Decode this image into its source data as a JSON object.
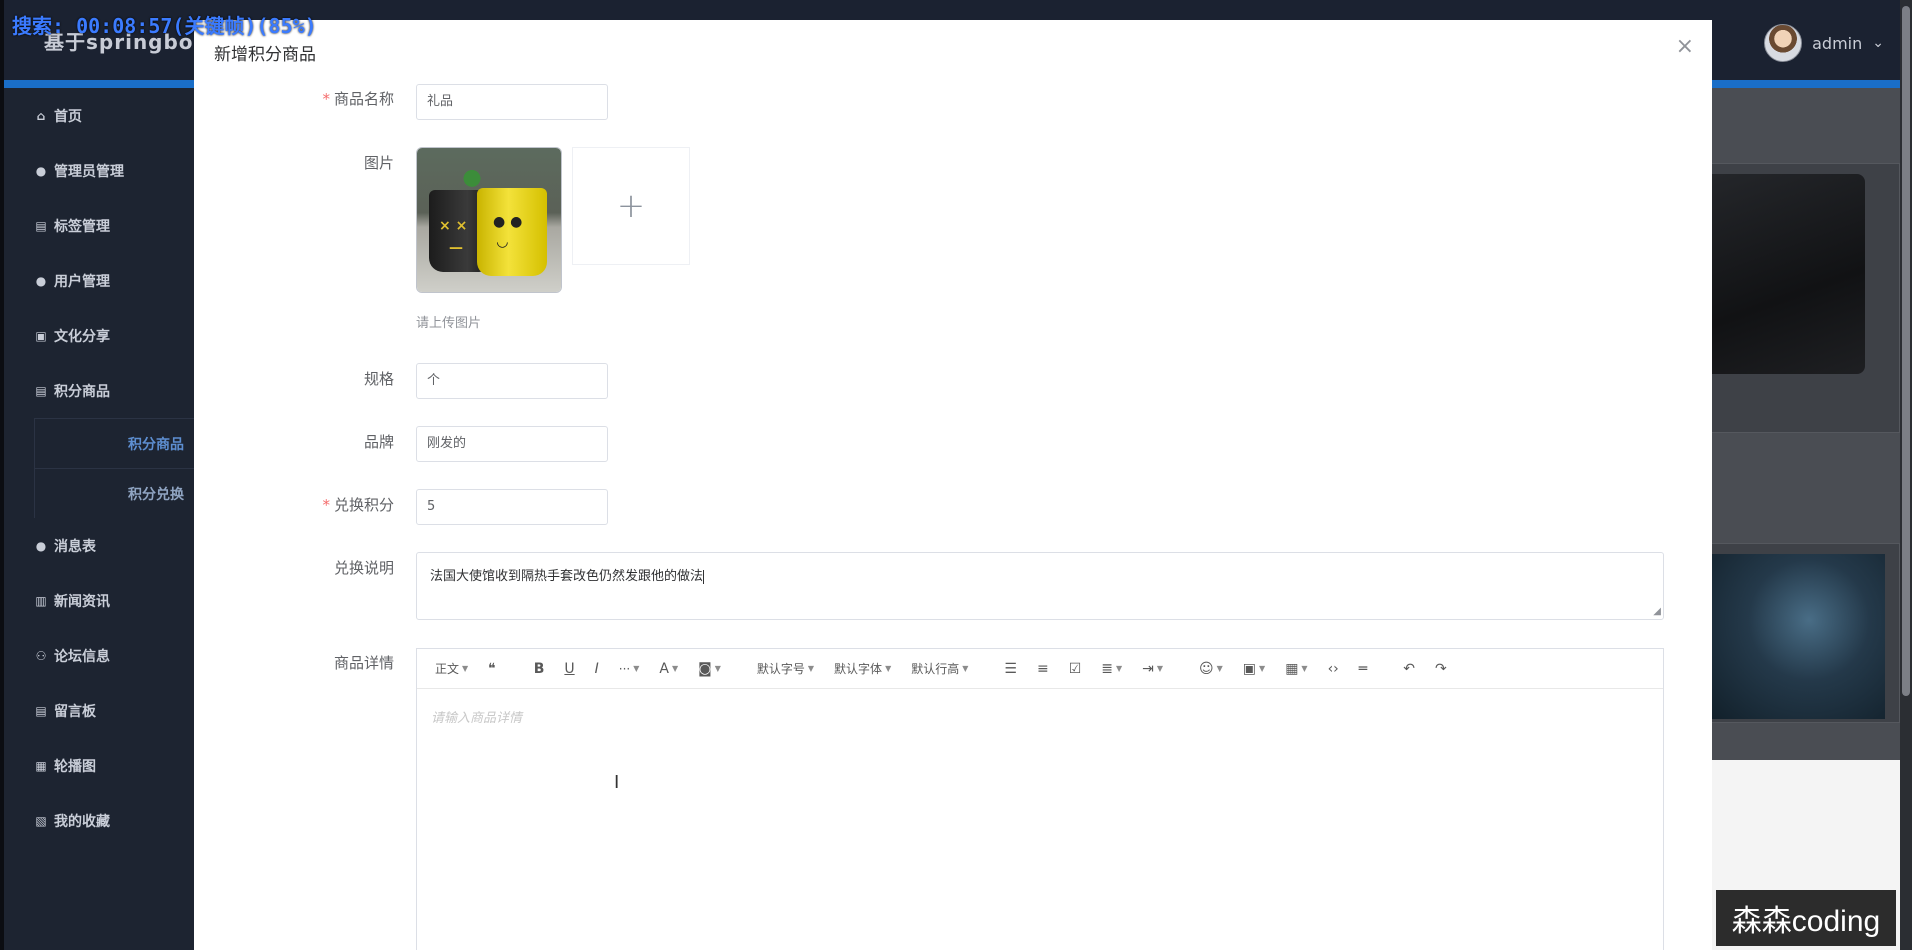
{
  "app": {
    "title": "基于springboot",
    "user_name": "admin"
  },
  "overlay": {
    "status": "搜索: 00:08:57(关键帧)(85%)",
    "watermark": "森森coding"
  },
  "sidebar": {
    "items": [
      {
        "label": "首页",
        "icon": "home-icon"
      },
      {
        "label": "管理员管理",
        "icon": "user-icon"
      },
      {
        "label": "标签管理",
        "icon": "table-icon"
      },
      {
        "label": "用户管理",
        "icon": "user-icon"
      },
      {
        "label": "文化分享",
        "icon": "briefcase-icon"
      },
      {
        "label": "积分商品",
        "icon": "table-icon"
      }
    ],
    "sub_items": [
      {
        "label": "积分商品",
        "active": true
      },
      {
        "label": "积分兑换",
        "active": false
      }
    ],
    "items_after": [
      {
        "label": "消息表",
        "icon": "circle-icon"
      },
      {
        "label": "新闻资讯",
        "icon": "document-icon"
      },
      {
        "label": "论坛信息",
        "icon": "group-icon"
      },
      {
        "label": "留言板",
        "icon": "table-icon"
      },
      {
        "label": "轮播图",
        "icon": "grid-icon"
      },
      {
        "label": "我的收藏",
        "icon": "box-icon"
      }
    ]
  },
  "dialog": {
    "title": "新增积分商品",
    "fields": {
      "name": {
        "label": "商品名称",
        "value": "礼品",
        "required": true
      },
      "image": {
        "label": "图片",
        "hint": "请上传图片"
      },
      "spec": {
        "label": "规格",
        "value": "个"
      },
      "brand": {
        "label": "品牌",
        "value": "刚发的"
      },
      "points": {
        "label": "兑换积分",
        "value": "5",
        "required": true
      },
      "description": {
        "label": "兑换说明",
        "value": "法国大使馆收到隔热手套改色仍然发跟他的做法"
      },
      "detail": {
        "label": "商品详情",
        "placeholder": "请输入商品详情"
      }
    },
    "editor_toolbar": {
      "paragraph": "正文",
      "font_size": "默认字号",
      "font_family": "默认字体",
      "line_height": "默认行高",
      "more": "···"
    }
  },
  "colors": {
    "accent": "#1a6ec8",
    "sidebar_bg": "#1d2431",
    "required": "#f56c6c"
  }
}
